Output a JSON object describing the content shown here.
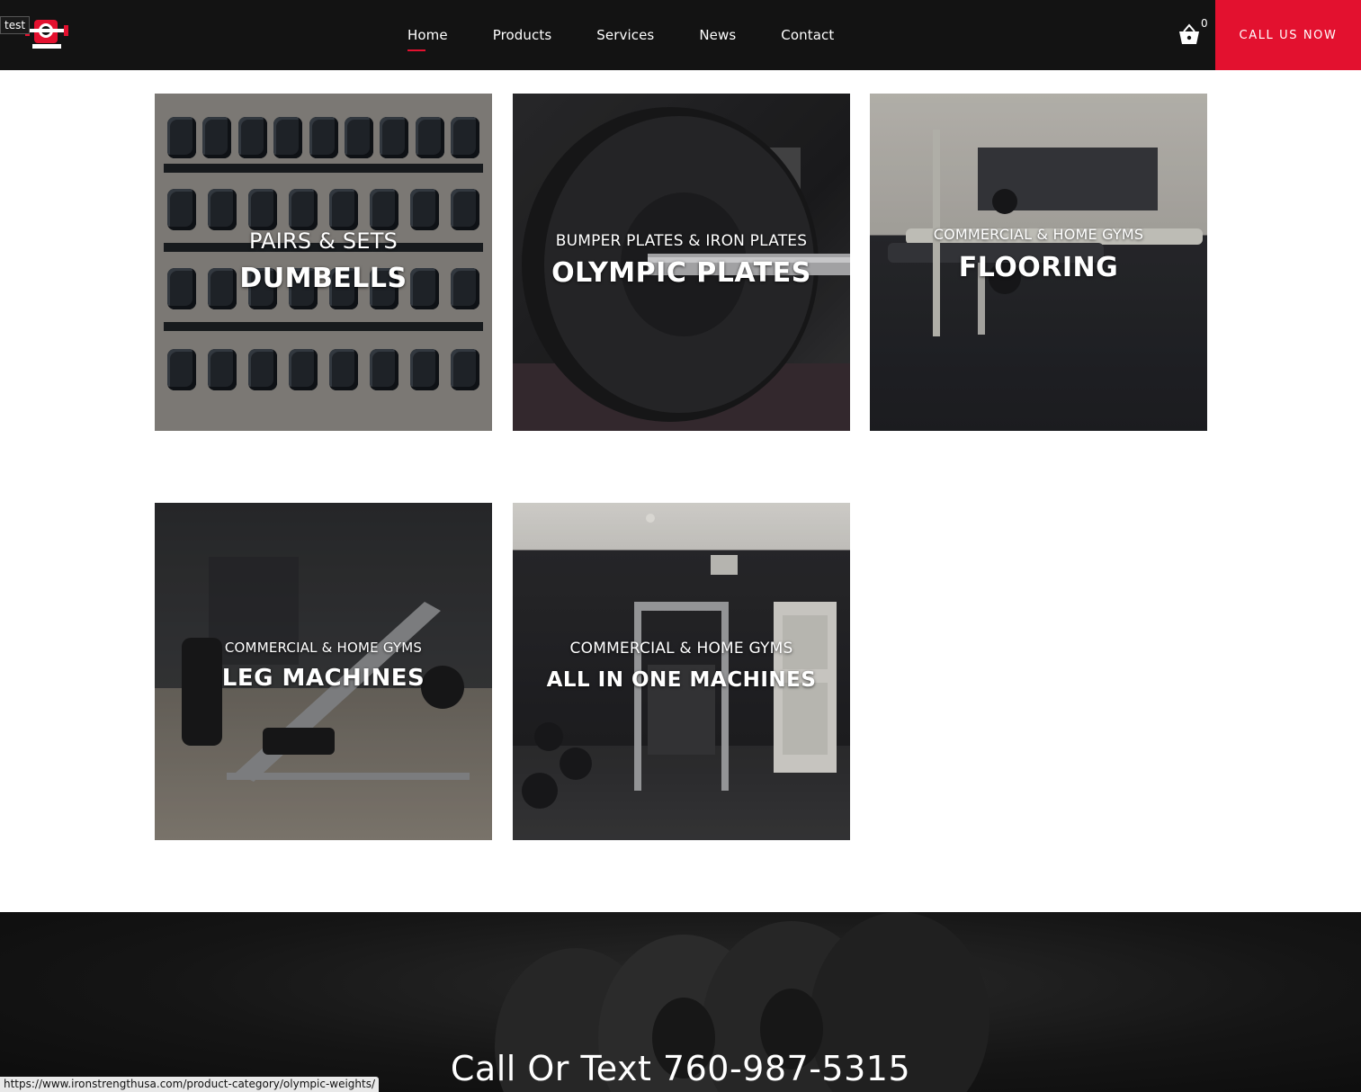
{
  "header": {
    "badge": "test",
    "nav": [
      "Home",
      "Products",
      "Services",
      "News",
      "Contact"
    ],
    "active_nav": "Home",
    "cart_count": "0",
    "cta_label": "CALL US NOW"
  },
  "tiles": [
    {
      "subtitle": "PAIRS & SETS",
      "title": "DUMBELLS"
    },
    {
      "subtitle": "BUMPER PLATES & IRON PLATES",
      "title": "OLYMPIC PLATES"
    },
    {
      "subtitle": "COMMERCIAL & HOME GYMS",
      "title": "FLOORING"
    },
    {
      "subtitle": "COMMERCIAL & HOME GYMS",
      "title": "LEG MACHINES"
    },
    {
      "subtitle": "COMMERCIAL & HOME GYMS",
      "title": "ALL IN ONE MACHINES"
    }
  ],
  "band": {
    "phone_text": "Call Or Text 760-987-5315"
  },
  "status_bar": {
    "url": "https://www.ironstrengthusa.com/product-category/olympic-weights/"
  },
  "colors": {
    "header_bg": "#131313",
    "accent": "#e3112f"
  }
}
